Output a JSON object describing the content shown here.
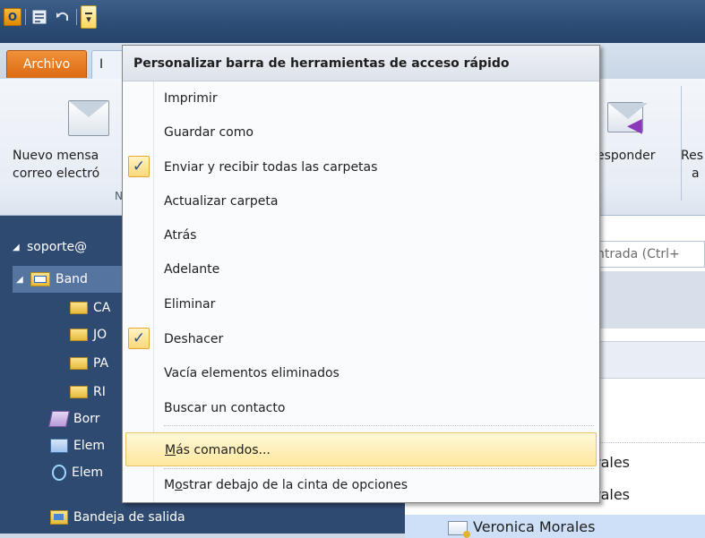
{
  "titlebar": {
    "app_icon_letter": "O",
    "qat_dropdown_glyph": "▾"
  },
  "tabs": {
    "file": "Archivo",
    "home_fragment": "I"
  },
  "ribbon": {
    "new_mail_line1": "Nuevo mensa",
    "new_mail_line2": "correo electró",
    "group_label_fragment": "N",
    "reply_label": "esponder",
    "reply_all_line1": "Res",
    "reply_all_line2": "a"
  },
  "nav": {
    "account": "soporte@",
    "inbox": "Band",
    "subfolders": [
      "CA",
      "JO",
      "PA",
      "RI"
    ],
    "drafts": "Borr",
    "sent": "Elem",
    "deleted": "Elem",
    "outbox": "Bandeja de salida"
  },
  "mail": {
    "search_placeholder": "ntrada (Ctrl+",
    "row1": "rales",
    "row2": "rales",
    "row3": "Veronica Morales"
  },
  "menu": {
    "title": "Personalizar barra de herramientas de acceso rápido",
    "check_glyph": "✓",
    "items": [
      {
        "label": "Imprimir",
        "checked": false
      },
      {
        "label": "Guardar como",
        "checked": false
      },
      {
        "label": "Enviar y recibir todas las carpetas",
        "checked": true
      },
      {
        "label": "Actualizar carpeta",
        "checked": false
      },
      {
        "label": "Atrás",
        "checked": false
      },
      {
        "label": "Adelante",
        "checked": false
      },
      {
        "label": "Eliminar",
        "checked": false
      },
      {
        "label": "Deshacer",
        "checked": true
      },
      {
        "label": "Vacía elementos eliminados",
        "checked": false
      },
      {
        "label": "Buscar un contacto",
        "checked": false
      }
    ],
    "more_commands": {
      "underlined": "M",
      "rest": "ás comandos..."
    },
    "show_below": {
      "first": "M",
      "underlined": "o",
      "rest": "strar debajo de la cinta de opciones"
    }
  },
  "colors": {
    "title_bar": "#2d4d77",
    "file_tab": "#dc6a12",
    "nav_pane": "#2f4a70",
    "menu_hover": "#fde89d",
    "check_bg": "#ffd87a"
  }
}
